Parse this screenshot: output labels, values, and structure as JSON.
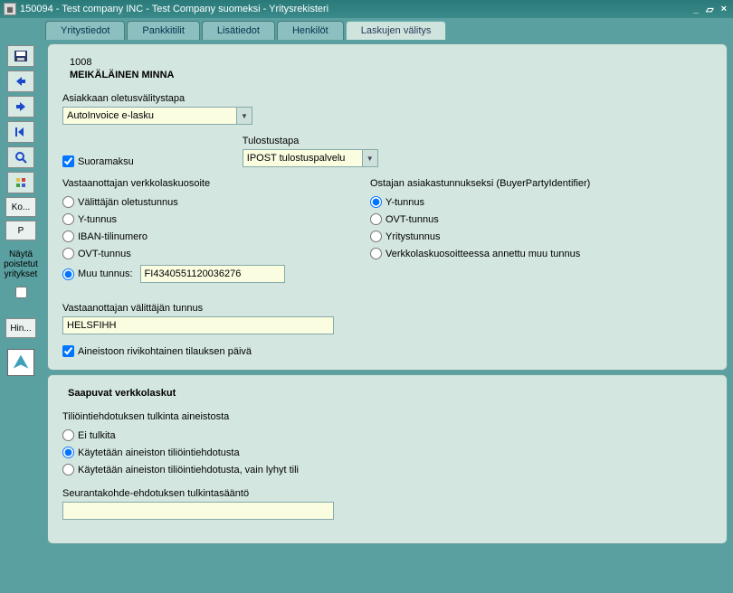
{
  "window": {
    "title": "150094 - Test company INC - Test Company suomeksi - Yritysrekisteri",
    "icon_label": "app"
  },
  "tabs": [
    {
      "label": "Yritystiedot"
    },
    {
      "label": "Pankkitilit"
    },
    {
      "label": "Lisätiedot"
    },
    {
      "label": "Henkilöt"
    },
    {
      "label": "Laskujen välitys"
    }
  ],
  "sidebar": {
    "group_label": "Näytä\npoistetut\nyritykset",
    "btn_ko": "Ko...",
    "btn_p": "P",
    "btn_hin": "Hin..."
  },
  "header": {
    "id": "1008",
    "name": "MEIKÄLÄINEN MINNA"
  },
  "form": {
    "default_method_label": "Asiakkaan oletusvälitystapa",
    "default_method_value": "AutoInvoice e-lasku",
    "direct_payment_label": "Suoramaksu",
    "print_method_label": "Tulostustapa",
    "print_method_value": "IPOST tulostuspalvelu",
    "recipient_address_label": "Vastaanottajan verkkolaskuosoite",
    "recipient_options": [
      {
        "label": "Välittäjän oletustunnus"
      },
      {
        "label": "Y-tunnus"
      },
      {
        "label": "IBAN-tilinumero"
      },
      {
        "label": "OVT-tunnus"
      },
      {
        "label": "Muu tunnus:"
      }
    ],
    "muu_tunnus_value": "FI4340551120036276",
    "buyer_id_label": "Ostajan asiakastunnukseksi (BuyerPartyIdentifier)",
    "buyer_id_options": [
      {
        "label": "Y-tunnus"
      },
      {
        "label": "OVT-tunnus"
      },
      {
        "label": "Yritystunnus"
      },
      {
        "label": "Verkkolaskuosoitteessa annettu muu tunnus"
      }
    ],
    "intermediary_label": "Vastaanottajan välittäjän tunnus",
    "intermediary_value": "HELSFIHH",
    "order_date_label": "Aineistoon rivikohtainen tilauksen päivä"
  },
  "incoming": {
    "title": "Saapuvat verkkolaskut",
    "interpretation_label": "Tiliöintiehdotuksen tulkinta aineistosta",
    "interpretation_options": [
      {
        "label": "Ei tulkita"
      },
      {
        "label": "Käytetään aineiston tiliöintiehdotusta"
      },
      {
        "label": "Käytetään aineiston tiliöintiehdotusta, vain lyhyt tili"
      }
    ],
    "tracking_label": "Seurantakohde-ehdotuksen tulkintasääntö",
    "tracking_value": ""
  }
}
